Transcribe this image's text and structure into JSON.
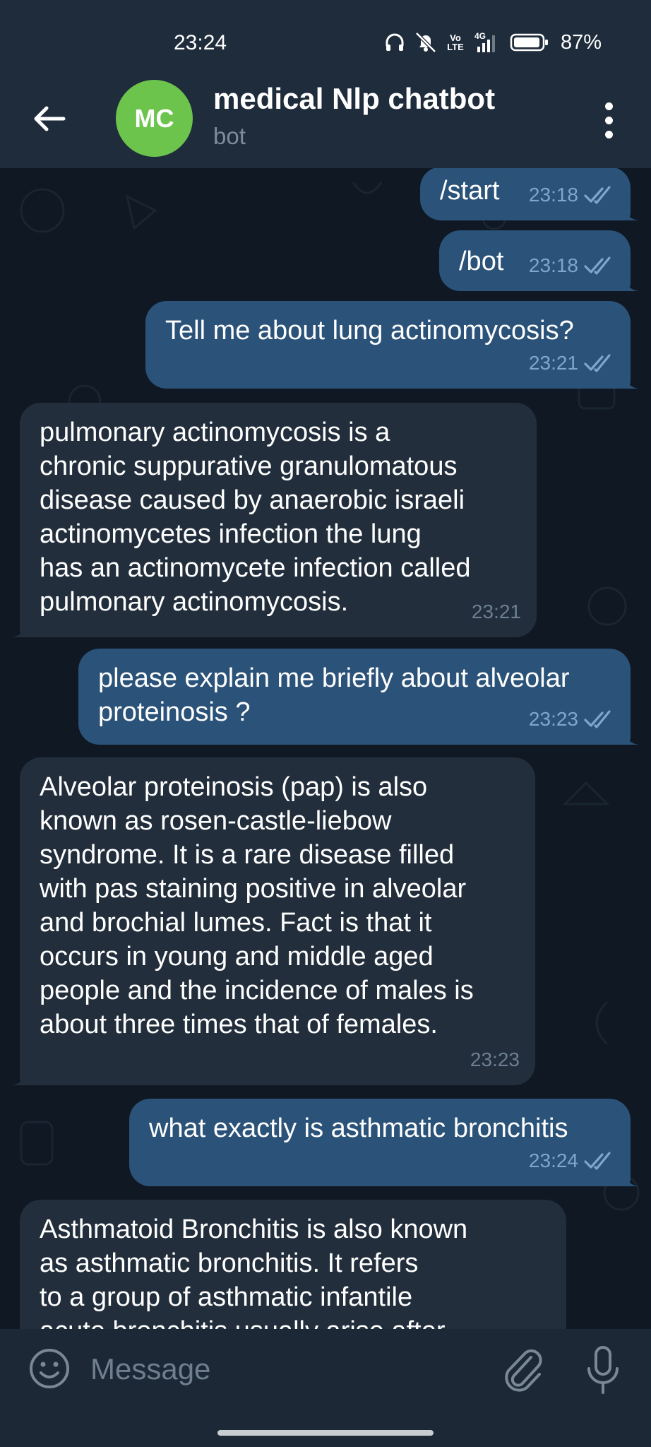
{
  "status_bar": {
    "time": "23:24",
    "lte_label": "Vo LTE",
    "network": "4G",
    "battery": "87%"
  },
  "header": {
    "avatar_initials": "MC",
    "title": "medical Nlp chatbot",
    "subtitle": "bot"
  },
  "messages": [
    {
      "direction": "out",
      "text": "/start",
      "time": "23:18",
      "read": true
    },
    {
      "direction": "out",
      "text": "/bot",
      "time": "23:18",
      "read": true
    },
    {
      "direction": "out",
      "text": "Tell me about lung actinomycosis?",
      "time": "23:21",
      "read": true
    },
    {
      "direction": "in",
      "text": "pulmonary actinomycosis is a\nchronic suppurative granulomatous\ndisease caused by anaerobic israeli\nactinomycetes infection the lung\nhas an actinomycete infection called\npulmonary actinomycosis.",
      "time": "23:21"
    },
    {
      "direction": "out",
      "text": "please explain me briefly about alveolar\nproteinosis ?",
      "time": "23:23",
      "read": true
    },
    {
      "direction": "in",
      "text": "Alveolar proteinosis (pap) is also\nknown as rosen-castle-liebow\nsyndrome. It is a rare disease filled\nwith pas staining positive in alveolar\nand brochial lumes. Fact is that it\noccurs in young and middle aged\npeople and the incidence of males is\nabout three times that of females.",
      "time": "23:23"
    },
    {
      "direction": "out",
      "text": "what exactly is asthmatic bronchitis",
      "time": "23:24",
      "read": true
    },
    {
      "direction": "in",
      "text": "Asthmatoid Bronchitis is also known\nas asthmatic bronchitis. It refers\nto a group of asthmatic infantile\nacute bronchitis usually arise after",
      "time": ""
    }
  ],
  "input": {
    "placeholder": "Message",
    "value": ""
  },
  "colors": {
    "header_bg": "#1f2c3b",
    "chat_bg": "#0f1823",
    "outgoing_bubble": "#2b5278",
    "incoming_bubble": "#222e3c",
    "avatar": "#6cc44d",
    "read_check": "#7fa6cc"
  },
  "icons": {
    "back": "arrow-left-icon",
    "more": "more-vertical-icon",
    "emoji": "emoji-smile-icon",
    "attach": "paperclip-icon",
    "mic": "microphone-icon",
    "read": "double-check-icon"
  }
}
